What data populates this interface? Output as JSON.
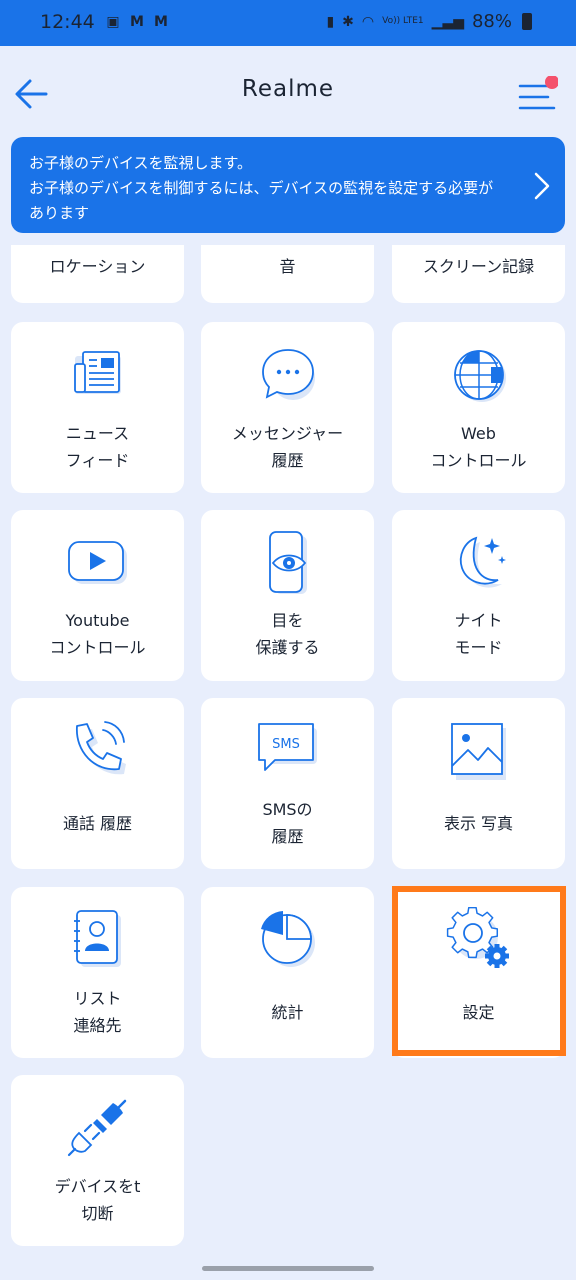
{
  "status_bar": {
    "time": "12:44",
    "battery": "88%",
    "volte": "Vo)) LTE1"
  },
  "header": {
    "title": "Realme"
  },
  "banner": {
    "line1": "お子様のデバイスを監視します。",
    "line2": "お子様のデバイスを制御するには、デバイスの監視を設定する必要があります"
  },
  "partial_tiles": [
    {
      "label": "ロケーション"
    },
    {
      "label": "音"
    },
    {
      "label": "スクリーン記録"
    }
  ],
  "tiles": [
    {
      "line1": "ニュース",
      "line2": "フィード",
      "icon": "newspaper-icon"
    },
    {
      "line1": "メッセンジャー",
      "line2": "履歴",
      "icon": "chat-bubble-icon"
    },
    {
      "line1": "Web",
      "line2": "コントロール",
      "icon": "globe-icon"
    },
    {
      "line1": "Youtube",
      "line2": "コントロール",
      "icon": "play-video-icon"
    },
    {
      "line1": "目を",
      "line2": "保護する",
      "icon": "eye-phone-icon"
    },
    {
      "line1": "ナイト",
      "line2": "モード",
      "icon": "moon-stars-icon"
    },
    {
      "line1": "通話 履歴",
      "line2": "",
      "icon": "phone-call-icon"
    },
    {
      "line1": "SMSの",
      "line2": "履歴",
      "icon": "sms-icon",
      "icon_text": "SMS"
    },
    {
      "line1": "表示 写真",
      "line2": "",
      "icon": "photo-icon"
    },
    {
      "line1": "リスト",
      "line2": "連絡先",
      "icon": "contacts-book-icon"
    },
    {
      "line1": "統計",
      "line2": "",
      "icon": "pie-chart-icon"
    },
    {
      "line1": "設定",
      "line2": "",
      "icon": "gear-icon"
    },
    {
      "line1": "デバイスをt",
      "line2": "切断",
      "icon": "plug-disconnect-icon"
    }
  ],
  "colors": {
    "accent": "#1a73e8",
    "background": "#e8eefc",
    "highlight": "#ff7a1a",
    "notification_dot": "#f4516c"
  }
}
